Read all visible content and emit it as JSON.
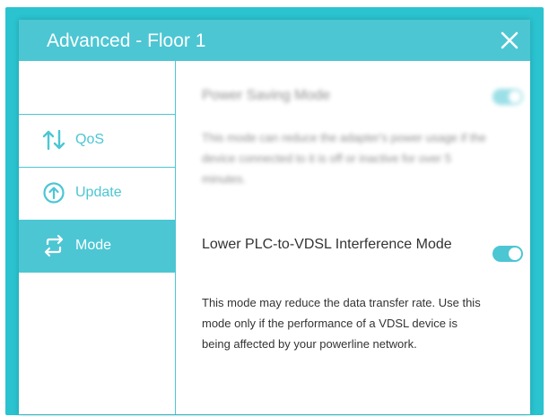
{
  "dialog": {
    "title": "Advanced - Floor 1",
    "close_icon": "close-icon"
  },
  "sidebar": {
    "items": [
      {
        "label": "QoS",
        "icon": "qos-arrows-icon",
        "active": false
      },
      {
        "label": "Update",
        "icon": "update-arrow-icon",
        "active": false
      },
      {
        "label": "Mode",
        "icon": "mode-swap-icon",
        "active": true
      }
    ]
  },
  "settings": {
    "power_saving": {
      "title": "Power Saving Mode",
      "description": "This mode can reduce the adapter's power usage if the device connected to it is off or inactive for over 5 minutes.",
      "enabled": true,
      "blurred": true
    },
    "plc_vdsl": {
      "title": "Lower PLC-to-VDSL Interference Mode",
      "description": "This mode may reduce the data transfer rate. Use this mode only if the performance of a VDSL device is being affected by your powerline network.",
      "enabled": true
    }
  },
  "colors": {
    "accent": "#4cc6d3",
    "outer_frame": "#2ac3cf",
    "text": "#333333",
    "background": "#ffffff"
  }
}
